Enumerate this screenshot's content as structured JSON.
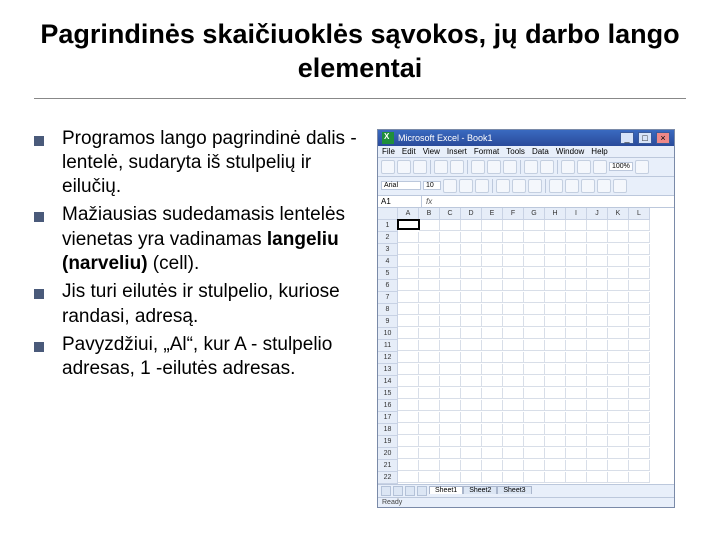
{
  "title": "Pagrindinės skaičiuoklės sąvokos, jų darbo lango elementai",
  "bullets": [
    {
      "html": "Programos lango pagrindinė dalis - lentelė, sudaryta iš stulpelių ir eilučių."
    },
    {
      "html": "Mažiausias sudedamasis lentelės vienetas yra vadinamas <b>langeliu (narveliu)</b> (cell)."
    },
    {
      "html": "Jis turi eilutės ir stulpelio, kuriose randasi, adresą."
    },
    {
      "html": "Pavyzdžiui, „Al“, kur A - stulpelio adresas, 1 -eilutės adresas."
    }
  ],
  "excel": {
    "title": "Microsoft Excel - Book1",
    "menu": [
      "File",
      "Edit",
      "View",
      "Insert",
      "Format",
      "Tools",
      "Data",
      "Window",
      "Help"
    ],
    "font": "Arial",
    "fontsize": "10",
    "zoom": "100%",
    "namebox": "A1",
    "fx": "fx",
    "columns": [
      "A",
      "B",
      "C",
      "D",
      "E",
      "F",
      "G",
      "H",
      "I",
      "J",
      "K",
      "L"
    ],
    "rows": 22,
    "sheets": [
      "Sheet1",
      "Sheet2",
      "Sheet3"
    ],
    "status": "Ready"
  }
}
